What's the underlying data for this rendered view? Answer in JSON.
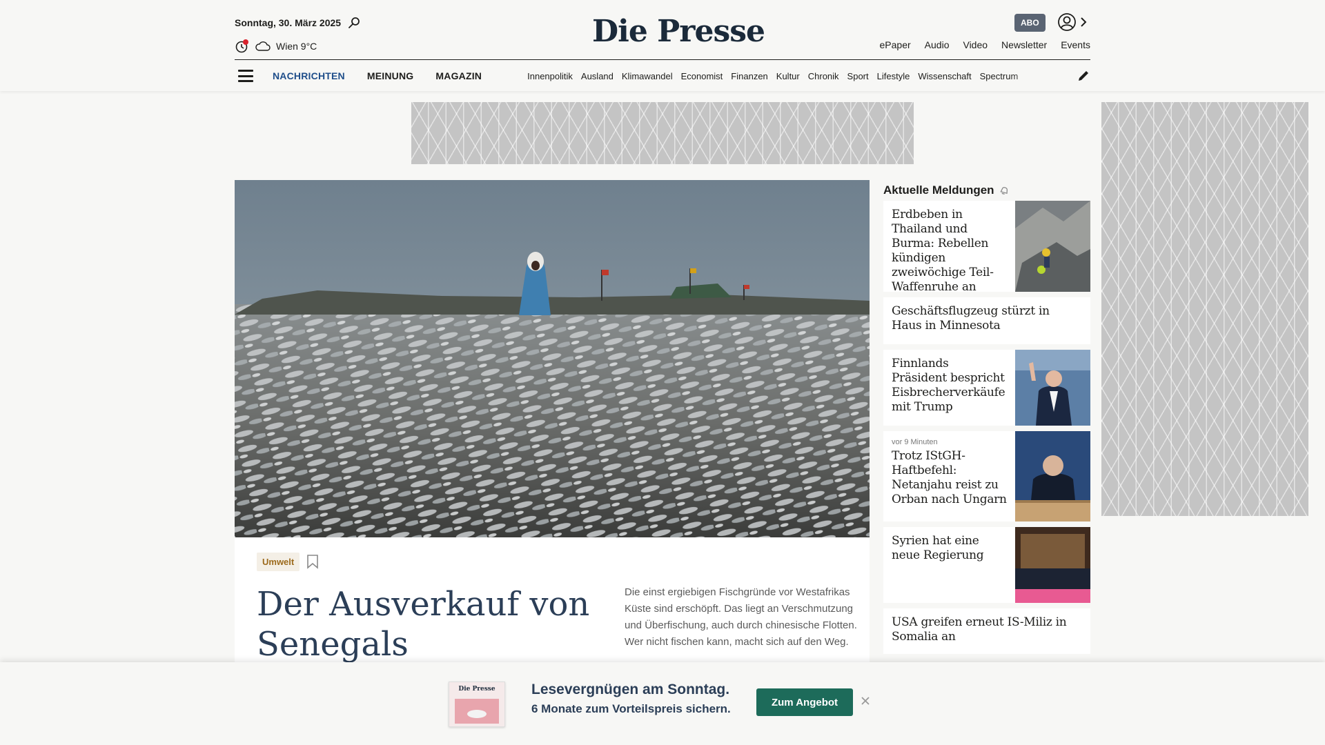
{
  "header": {
    "date": "Sonntag, 30. März 2025",
    "weather": "Wien 9°C",
    "logo": "Die Presse",
    "abo_label": "ABO",
    "utility_nav": [
      "ePaper",
      "Audio",
      "Video",
      "Newsletter",
      "Events"
    ]
  },
  "nav": {
    "primary": [
      "NACHRICHTEN",
      "MEINUNG",
      "MAGAZIN"
    ],
    "sections": [
      "Innenpolitik",
      "Ausland",
      "Klimawandel",
      "Economist",
      "Finanzen",
      "Kultur",
      "Chronik",
      "Sport",
      "Lifestyle",
      "Wissenschaft",
      "Spectrum"
    ]
  },
  "hero": {
    "category": "Umwelt",
    "headline": "Der Ausverkauf von Senegals Fischreichtum",
    "teaser": "Die einst ergiebigen Fischgründe vor Westafrikas Küste sind erschöpft. Das liegt an Verschmutzung und Überfischung, auch durch chinesische Flotten. Wer nicht fischen kann, macht sich auf den Weg."
  },
  "news": {
    "title": "Aktuelle Meldungen",
    "items": [
      {
        "time": "",
        "headline": "Erdbeben in Thailand und Burma: Rebellen kündigen zweiwöchige Teil-Waffenruhe an"
      },
      {
        "time": "",
        "headline": "Geschäftsflugzeug stürzt in Haus in Minnesota"
      },
      {
        "time": "",
        "headline": "Finnlands Präsident bespricht Eisbrecherverkäufe mit Trump"
      },
      {
        "time": "vor 9 Minuten",
        "headline": "Trotz IStGH-Haftbefehl: Netanjahu reist zu Orban nach Ungarn"
      },
      {
        "time": "",
        "headline": "Syrien hat eine neue Regierung"
      },
      {
        "time": "",
        "headline": "USA greifen erneut IS-Miliz in Somalia an"
      }
    ]
  },
  "promo": {
    "line1": "Lesevergnügen am Sonntag.",
    "line2": "6 Monate zum Vorteilspreis sichern.",
    "cta": "Zum Angebot",
    "thumb_logo": "Die Presse"
  }
}
